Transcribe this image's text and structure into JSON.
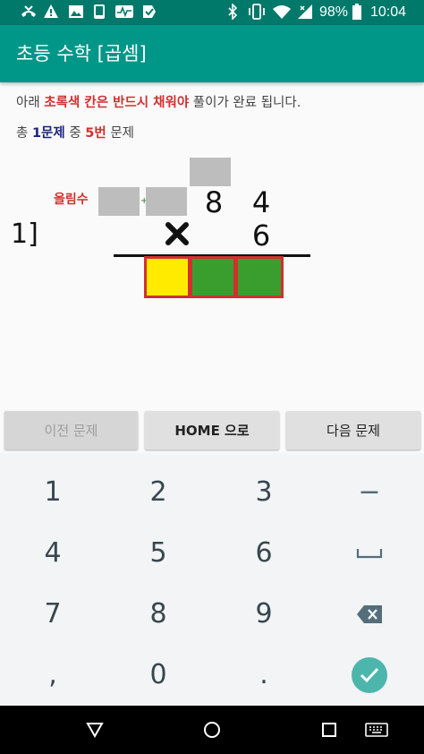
{
  "status_bar": {
    "battery": "98%",
    "time": "10:04",
    "bg": "#00796b"
  },
  "app_bar": {
    "title": "초등 수학 [곱셈]",
    "color": "#009688"
  },
  "instruction": {
    "prefix": "아래 ",
    "highlight": "초록색 칸은 반드시 채워야",
    "suffix": " 풀이가 완료 됩니다."
  },
  "progress": {
    "p1": "총 ",
    "total": "1문제",
    "p2": " 중 ",
    "current": "5번",
    "p3": " 문제"
  },
  "problem": {
    "number": "1]",
    "carry_label": "올림수",
    "plus": "+",
    "multiplicand_tens": "8",
    "multiplicand_ones": "4",
    "multiplier": "6",
    "operator_icon": "multiply-icon",
    "answer_cells": [
      {
        "state": "active",
        "color": "#ffeb00"
      },
      {
        "state": "required",
        "color": "#3a9e2f"
      },
      {
        "state": "required",
        "color": "#3a9e2f"
      }
    ]
  },
  "buttons": {
    "prev": "이전 문제",
    "home": "HOME 으로",
    "next": "다음 문제"
  },
  "keypad": {
    "rows": [
      [
        "1",
        "2",
        "3",
        "−"
      ],
      [
        "4",
        "5",
        "6",
        "␣"
      ],
      [
        "7",
        "8",
        "9",
        "⌫"
      ],
      [
        ",",
        "0",
        ".",
        "✓"
      ]
    ],
    "fn_icons": [
      "minus-key",
      "space-icon",
      "backspace-icon",
      "checkmark-icon"
    ],
    "enter_color": "#4db6ac"
  },
  "nav_bar": {
    "icons": [
      "back-icon",
      "home-icon",
      "recents-icon",
      "keyboard-switch-icon"
    ]
  }
}
